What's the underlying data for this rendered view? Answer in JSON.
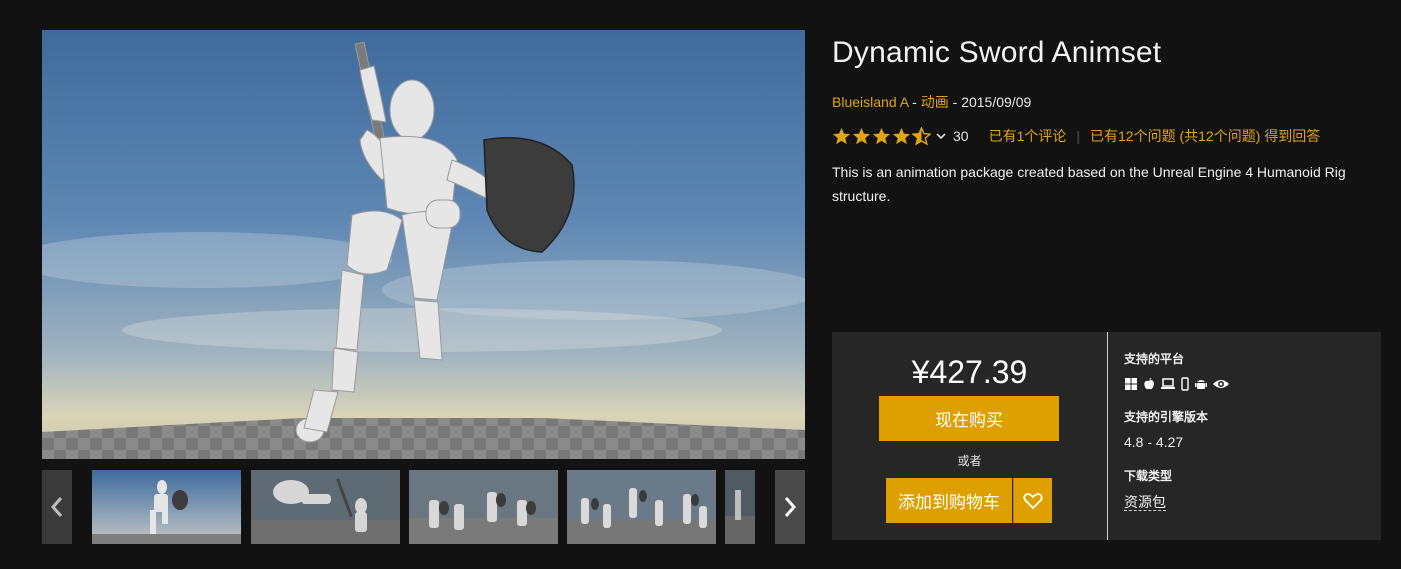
{
  "product": {
    "title": "Dynamic Sword Animset",
    "seller": "Blueisland A",
    "sep1": " - ",
    "category": "动画",
    "sep2": " - ",
    "date": "2015/09/09",
    "rating": 4.5,
    "rating_count": "30",
    "reviews_link": "已有1个评论",
    "questions_link": "已有12个问题 (共12个问题) 得到回答",
    "description": "This is an animation package created based on the Unreal Engine 4 Humanoid Rig structure."
  },
  "purchase": {
    "price": "¥427.39",
    "buy_label": "现在购买",
    "or_label": "或者",
    "cart_label": "添加到购物车",
    "wishlist_icon": "heart-icon",
    "button_color": "#dda000"
  },
  "details": {
    "platforms_label": "支持的平台",
    "platform_icons": [
      "windows-icon",
      "apple-icon",
      "laptop-icon",
      "phone-icon",
      "android-icon",
      "eye-icon"
    ],
    "engine_label": "支持的引擎版本",
    "engine_versions": "4.8 - 4.27",
    "download_label": "下载类型",
    "download_type": "资源包"
  },
  "gallery": {
    "prev_icon": "chevron-left-icon",
    "next_icon": "chevron-right-icon",
    "thumbnail_count_visible": 5,
    "selected_index": 0
  },
  "colors": {
    "background": "#121212",
    "accent": "#e0a516",
    "panel": "#262626"
  }
}
